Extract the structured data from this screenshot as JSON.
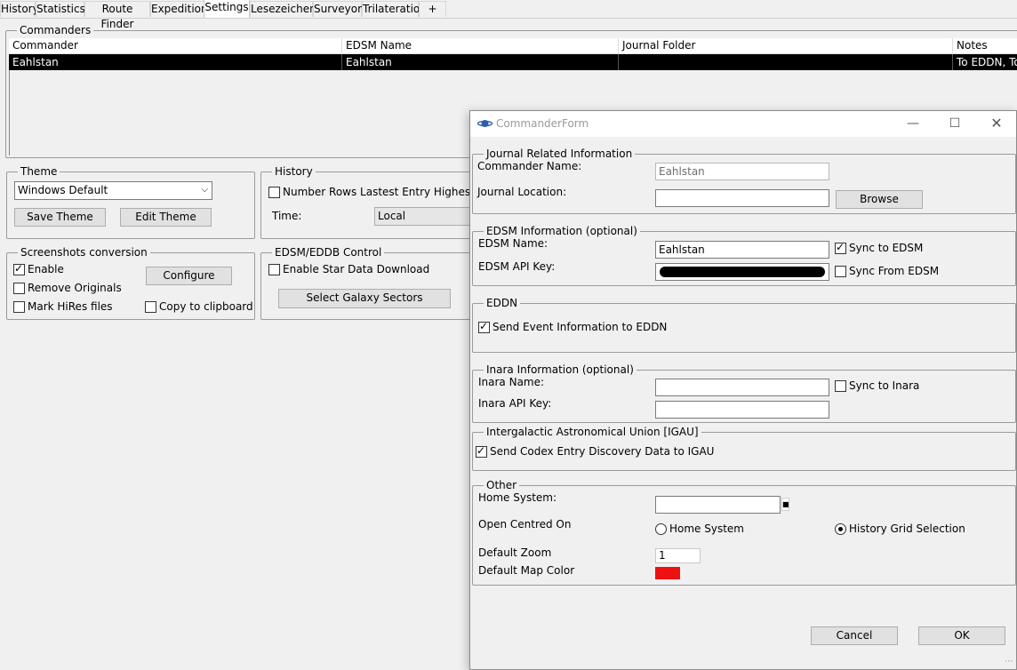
{
  "tabs": [
    "History",
    "Statistics",
    "Route Finder",
    "Expedition",
    "Settings",
    "Lesezeichen",
    "Surveyor",
    "Trilateration",
    "+"
  ],
  "commanders": {
    "title": "Commanders",
    "columns": [
      "Commander",
      "EDSM Name",
      "Journal Folder",
      "Notes"
    ],
    "rows": [
      {
        "commander": "Eahlstan",
        "edsm_name": "Eahlstan",
        "journal_folder": "",
        "notes": "To EDDN, To"
      }
    ]
  },
  "theme": {
    "title": "Theme",
    "selected": "Windows Default",
    "save_label": "Save Theme",
    "edit_label": "Edit Theme"
  },
  "history": {
    "title": "History",
    "number_rows_label": "Number Rows Lastest Entry Highest",
    "number_rows_checked": false,
    "time_label": "Time:",
    "time_value": "Local"
  },
  "screenshots": {
    "title": "Screenshots conversion",
    "enable_label": "Enable",
    "enable_checked": true,
    "configure_label": "Configure",
    "remove_originals_label": "Remove Originals",
    "remove_originals_checked": false,
    "mark_hires_label": "Mark HiRes files",
    "mark_hires_checked": false,
    "copy_clipboard_label": "Copy to clipboard",
    "copy_clipboard_checked": false
  },
  "edsm_control": {
    "title": "EDSM/EDDB Control",
    "star_data_label": "Enable Star Data Download",
    "star_data_checked": false,
    "galaxy_sectors_label": "Select Galaxy Sectors"
  },
  "commander_form": {
    "window_title": "CommanderForm",
    "journal": {
      "title": "Journal Related Information",
      "commander_name_label": "Commander Name:",
      "commander_name_value": "Eahlstan",
      "journal_location_label": "Journal Location:",
      "journal_location_value": "",
      "browse_label": "Browse"
    },
    "edsm": {
      "title": "EDSM Information (optional)",
      "name_label": "EDSM Name:",
      "name_value": "Eahlstan",
      "api_key_label": "EDSM API Key:",
      "sync_to_label": "Sync to EDSM",
      "sync_to_checked": true,
      "sync_from_label": "Sync From EDSM",
      "sync_from_checked": false
    },
    "eddn": {
      "title": "EDDN",
      "send_label": "Send Event Information to EDDN",
      "send_checked": true
    },
    "inara": {
      "title": "Inara Information (optional)",
      "name_label": "Inara Name:",
      "name_value": "",
      "api_key_label": "Inara API Key:",
      "api_key_value": "",
      "sync_label": "Sync to Inara",
      "sync_checked": false
    },
    "igau": {
      "title": "Intergalactic Astronomical Union [IGAU]",
      "send_label": "Send Codex Entry Discovery Data to IGAU",
      "send_checked": true
    },
    "other": {
      "title": "Other",
      "home_system_label": "Home System:",
      "home_system_value": "",
      "open_centred_label": "Open Centred On",
      "radio_home_label": "Home System",
      "radio_grid_label": "History Grid Selection",
      "selected_radio": "History Grid Selection",
      "default_zoom_label": "Default Zoom",
      "default_zoom_value": "1",
      "default_map_color_label": "Default Map Color",
      "default_map_color": "#ee1111"
    },
    "cancel_label": "Cancel",
    "ok_label": "OK"
  }
}
